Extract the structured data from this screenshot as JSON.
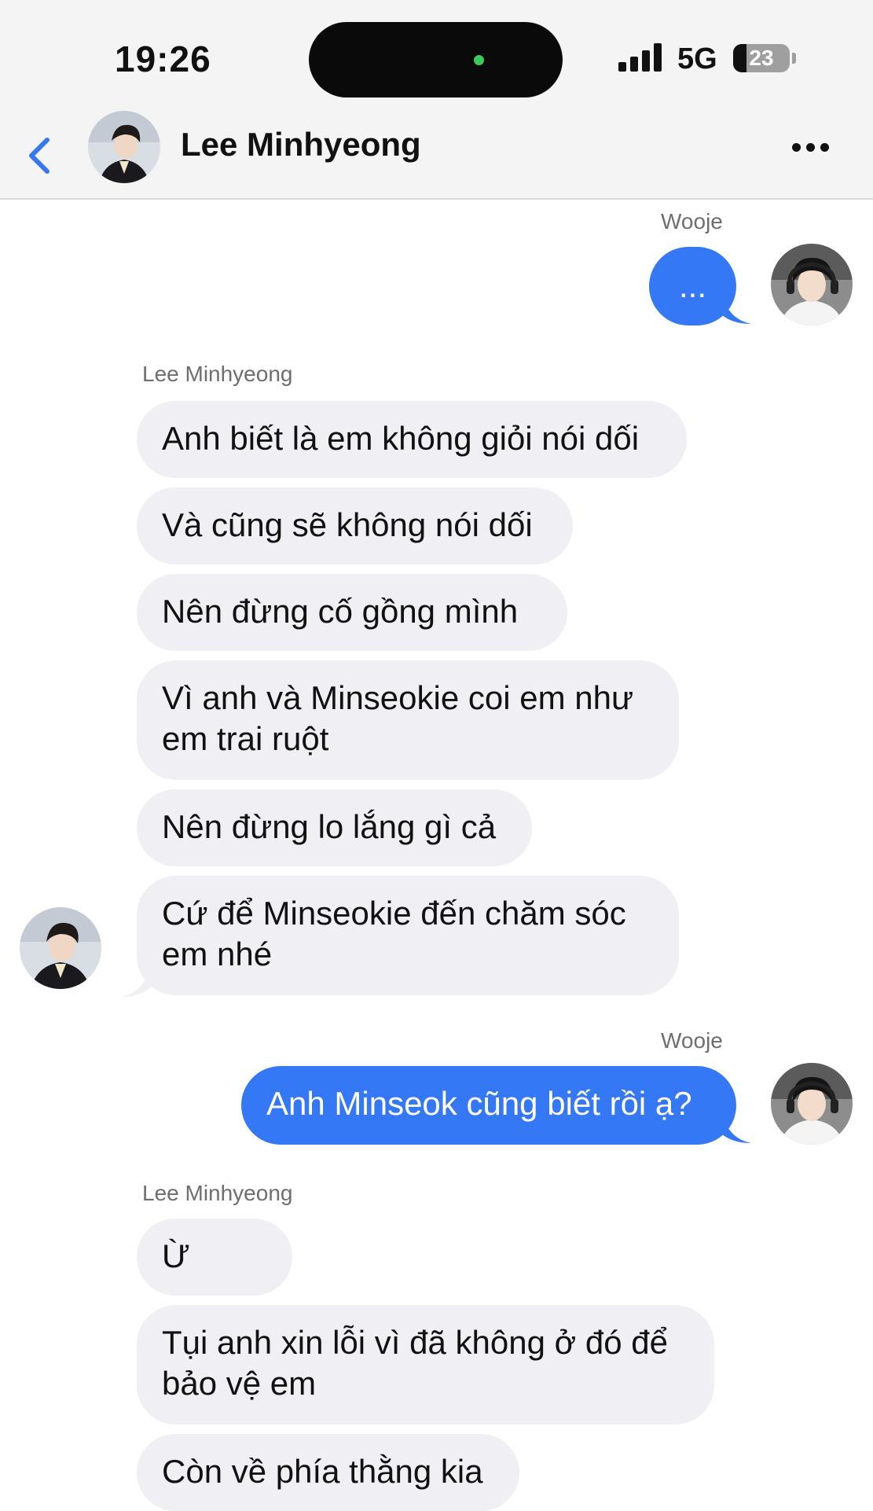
{
  "status_bar": {
    "time": "19:26",
    "network": "5G",
    "battery": "23",
    "battery_level": 0.23
  },
  "header": {
    "back_icon": "chevron-left-icon",
    "contact_name": "Lee Minhyeong",
    "more_icon": "more-horizontal-icon"
  },
  "colors": {
    "accent": "#3478f6",
    "incoming_bubble": "#efeff4",
    "header_bg": "#f4f4f4"
  },
  "thread": {
    "labels": [
      "Wooje",
      "Lee Minhyeong",
      "Wooje",
      "Lee Minhyeong"
    ],
    "messages": [
      "...",
      "Anh biết là em không giỏi nói dối",
      "Và cũng sẽ không nói dối",
      "Nên đừng cố gồng mình",
      "Vì anh và Minseokie coi em như em trai ruột",
      "Nên đừng lo lắng gì cả",
      "Cứ để Minseokie đến chăm sóc em nhé",
      "Anh Minseok cũng biết rồi ạ?",
      "Ừ",
      "Tụi anh xin lỗi vì đã không ở đó để bảo vệ em",
      "Còn về phía thằng kia"
    ]
  }
}
